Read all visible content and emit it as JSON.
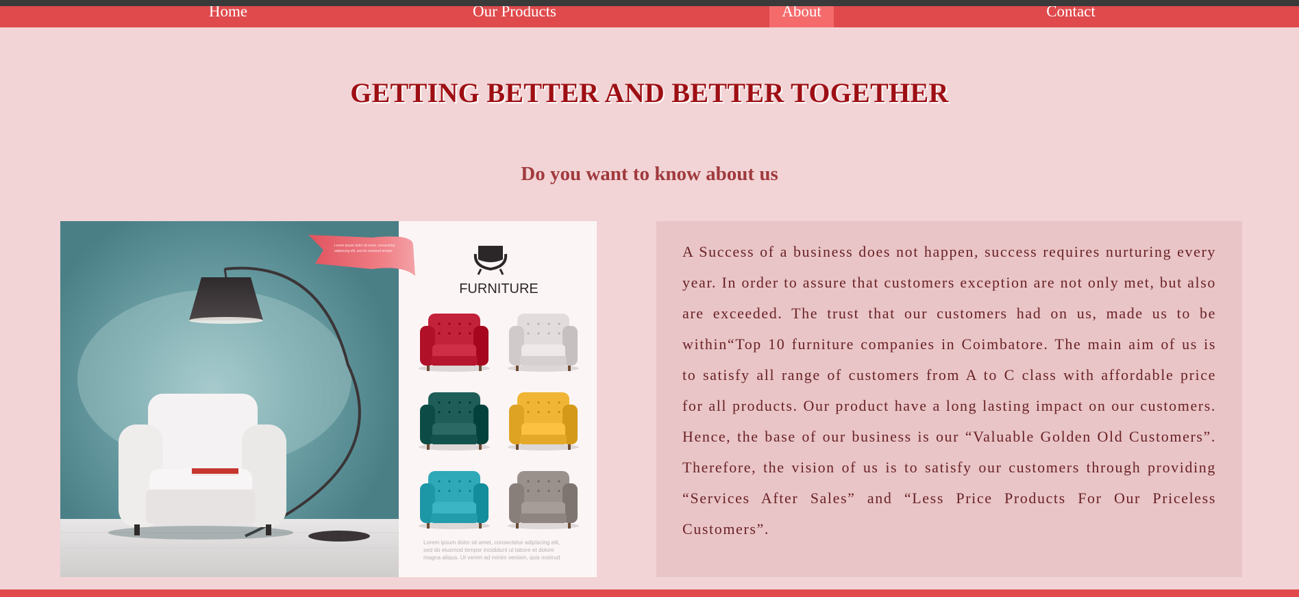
{
  "nav": {
    "items": [
      {
        "label": "Home",
        "active": false
      },
      {
        "label": "Our Products",
        "active": false
      },
      {
        "label": "About",
        "active": true
      },
      {
        "label": "Contact",
        "active": false
      }
    ]
  },
  "header": {
    "title": "GETTING BETTER AND BETTER TOGETHER",
    "subtitle": "Do you want to know about us"
  },
  "hero_image": {
    "brand_label": "FURNITURE",
    "ribbon_text": "Lorem ipsum dolor sit amet, consectetur adipiscing elit, sed do eiusmod tempor",
    "caption_text": "Lorem ipsum dolor sit amet, consectetur adipiscing elit, sed do eiusmod tempor incididunt ut labore et dolore magna aliqua. Ut venim ad minim veniam, quis nostrud",
    "chair_colors": [
      "#c2223a",
      "#e2dcdc",
      "#1f5e58",
      "#f0b535",
      "#2fa8b8",
      "#9b918c"
    ]
  },
  "about": {
    "text": "A Success of a business does not happen, success requires nurturing every year. In order to assure that customers exception are not only met, but also are exceeded. The trust that our customers had on us, made us to be within“Top 10 furniture companies in Coimbatore. The main aim of us is to satisfy all range of customers from A to C class with affordable price for all products. Our product have a long lasting impact on our customers. Hence, the base of our business is our “Valuable Golden Old Customers”. Therefore, the vision of us is to satisfy our customers through providing “Services After Sales” and “Less Price Products For Our Priceless Customers”."
  },
  "colors": {
    "navbar": "#e04a4c",
    "nav_active": "#f56b6c",
    "page_bg": "#f2d4d6",
    "title": "#9e0f14",
    "subtitle": "#a03a3e",
    "about_bg": "#e9c5c7",
    "about_text": "#6a2226"
  }
}
